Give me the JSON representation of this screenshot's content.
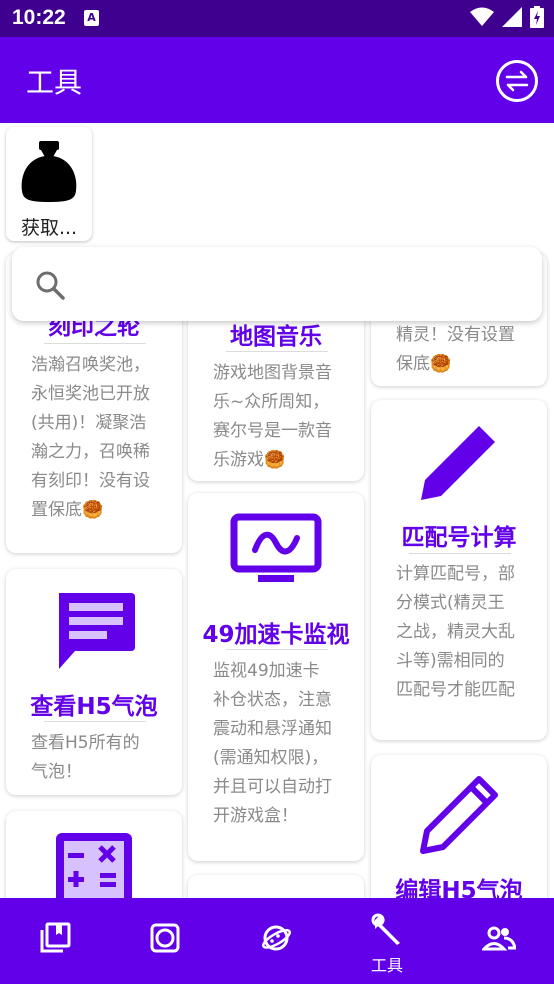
{
  "status_bar": {
    "time": "10:22",
    "notification_letter": "A"
  },
  "app_bar": {
    "title": "工具"
  },
  "top_tiles": [
    {
      "label": "获取..."
    }
  ],
  "search": {
    "placeholder": ""
  },
  "cards": [
    {
      "title": "刻印之轮",
      "desc": "浩瀚召唤奖池，永恒奖池已开放(共用)！凝聚浩瀚之力，召唤稀有刻印！没有设置保底🥮"
    },
    {
      "title": "查看H5气泡",
      "desc": "查看H5所有的气泡！"
    },
    {
      "title": "地图音乐",
      "desc": "游戏地图背景音乐~众所周知，赛尔号是一款音乐游戏🥮"
    },
    {
      "title": "49加速卡监视",
      "desc": "监视49加速卡补仓状态，注意震动和悬浮通知(需通知权限)，并且可以自动打开游戏盒！"
    },
    {
      "title": "",
      "desc": "精灵！没有设置保底🥮"
    },
    {
      "title": "匹配号计算",
      "desc": "计算匹配号，部分模式(精灵王之战，精灵大乱斗等)需相同的匹配号才能匹配"
    },
    {
      "title": "编辑H5气泡",
      "desc": ""
    }
  ],
  "bottom_nav": {
    "items": [
      {
        "icon": "collections-bookmark-icon",
        "label": ""
      },
      {
        "icon": "lens-icon",
        "label": ""
      },
      {
        "icon": "planet-icon",
        "label": ""
      },
      {
        "icon": "wrench-icon",
        "label": "工具"
      },
      {
        "icon": "people-icon",
        "label": ""
      }
    ]
  },
  "colors": {
    "primary": "#6200ea",
    "status_bar": "#3f008f",
    "accent_light": "#d7c2ff",
    "desc_text": "#8a8a8a"
  }
}
